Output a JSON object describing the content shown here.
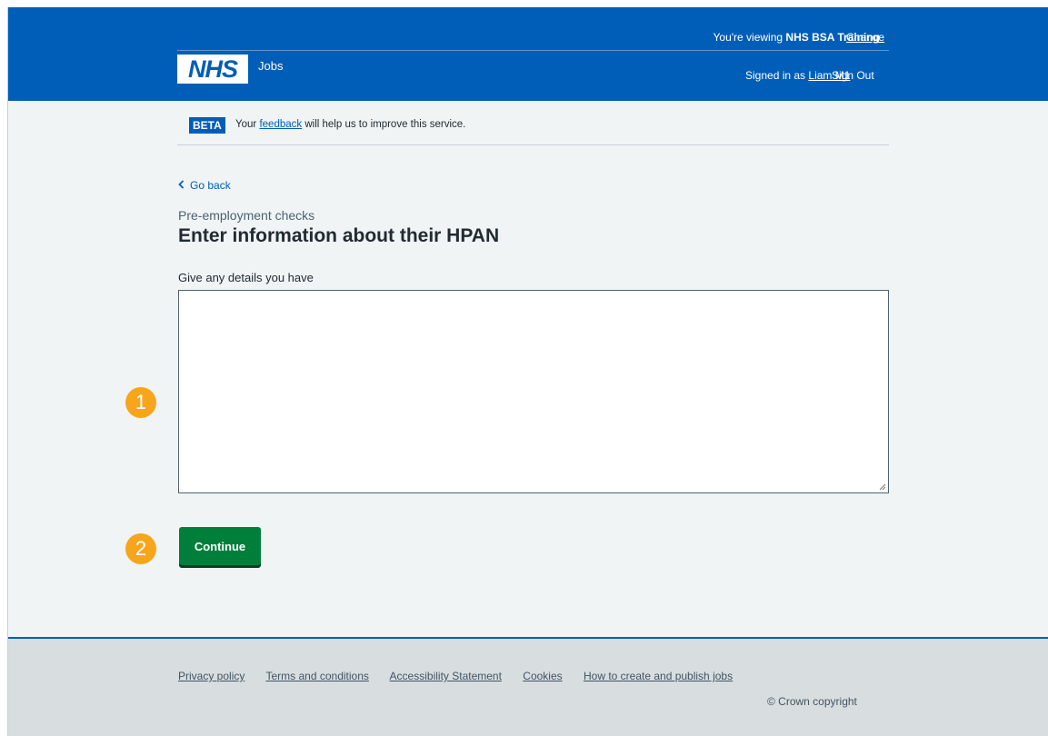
{
  "header": {
    "viewing_prefix": "You're viewing",
    "org_name": "NHS BSA Training",
    "change_label": "Change",
    "logo_text": "NHS",
    "service_name": "Jobs",
    "signed_in_prefix": "Signed in as",
    "user_name": "Liam M1",
    "sign_out_label": "Sign Out"
  },
  "beta": {
    "tag": "BETA",
    "text_before": "Your",
    "link": "feedback",
    "text_after": "will help us to improve this service."
  },
  "nav": {
    "go_back": "Go back"
  },
  "main": {
    "caption": "Pre-employment checks",
    "title": "Enter information about their HPAN",
    "field_label": "Give any details you have",
    "field_value": "",
    "continue_label": "Continue"
  },
  "markers": [
    "1",
    "2"
  ],
  "footer": {
    "links": [
      "Privacy policy",
      "Terms and conditions",
      "Accessibility Statement",
      "Cookies",
      "How to create and publish jobs"
    ],
    "copyright": "© Crown copyright"
  },
  "colors": {
    "brand_blue": "#005eb8",
    "button_green": "#007f3b",
    "marker_orange": "#f7a61b",
    "page_bg": "#f0f4f5"
  }
}
